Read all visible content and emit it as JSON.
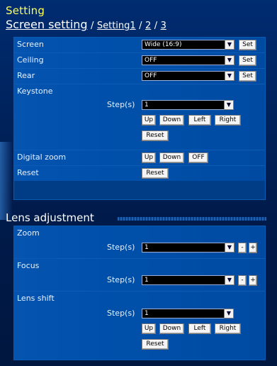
{
  "header": {
    "title": "Setting",
    "breadcrumb_main": "Screen setting",
    "sep1": "/",
    "link_setting1": "Setting1",
    "sep2": "/",
    "link_2": "2",
    "sep3": "/",
    "link_3": "3"
  },
  "screen_setting": {
    "screen": {
      "label": "Screen",
      "value": "Wide (16:9)",
      "button": "Set"
    },
    "ceiling": {
      "label": "Ceiling",
      "value": "OFF",
      "button": "Set"
    },
    "rear": {
      "label": "Rear",
      "value": "OFF",
      "button": "Set"
    },
    "keystone": {
      "label": "Keystone",
      "step_label": "Step(s)",
      "step_value": "1",
      "up": "Up",
      "down": "Down",
      "left": "Left",
      "right": "Right",
      "reset": "Reset"
    },
    "digital_zoom": {
      "label": "Digital zoom",
      "up": "Up",
      "down": "Down",
      "off": "OFF"
    },
    "reset": {
      "label": "Reset",
      "button": "Reset"
    }
  },
  "lens": {
    "title": "Lens adjustment",
    "zoom": {
      "label": "Zoom",
      "step_label": "Step(s)",
      "step_value": "1",
      "minus": "-",
      "plus": "+"
    },
    "focus": {
      "label": "Focus",
      "step_label": "Step(s)",
      "step_value": "1",
      "minus": "-",
      "plus": "+"
    },
    "lens_shift": {
      "label": "Lens shift",
      "step_label": "Step(s)",
      "step_value": "1",
      "up": "Up",
      "down": "Down",
      "left": "Left",
      "right": "Right",
      "reset": "Reset"
    }
  },
  "icons": {
    "dropdown": "chevron-down-icon"
  },
  "colors": {
    "title": "#ffff55",
    "panel": "#0050aa",
    "select_bg": "#000000"
  }
}
